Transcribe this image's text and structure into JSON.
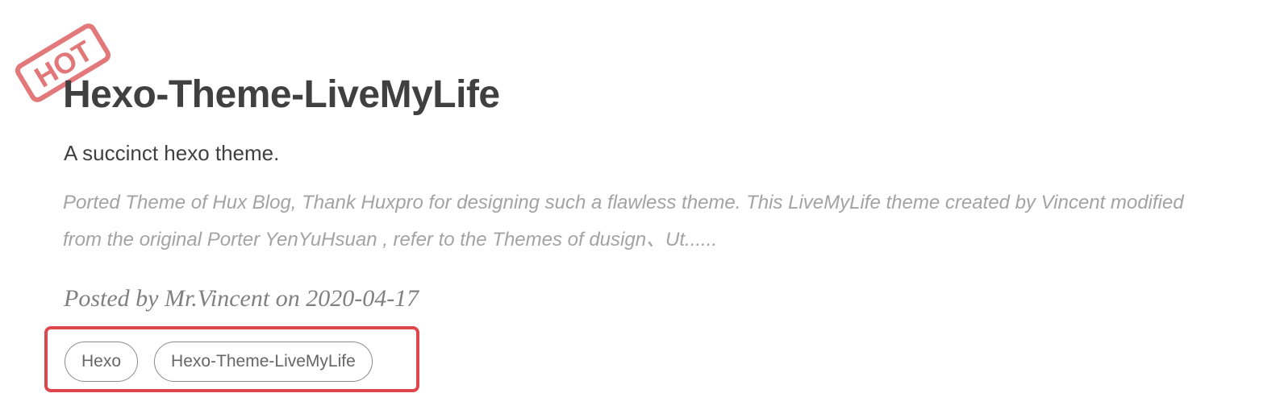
{
  "post": {
    "badge": "HOT",
    "badge_color": "#e06c6e",
    "title": "Hexo-Theme-LiveMyLife",
    "subtitle": "A succinct hexo theme.",
    "excerpt": "Ported Theme of Hux Blog, Thank Huxpro for designing such a flawless theme. This LiveMyLife theme created by Vincent modified from the original Porter YenYuHsuan , refer to the Themes of dusign、Ut......",
    "meta": "Posted by Mr.Vincent on 2020-04-17",
    "tags": [
      {
        "label": "Hexo"
      },
      {
        "label": "Hexo-Theme-LiveMyLife"
      }
    ]
  },
  "colors": {
    "title": "#404040",
    "excerpt": "#a3a3a3",
    "meta": "#808080",
    "highlight_box": "#e0474c",
    "tag_border": "#8a8a8a"
  }
}
